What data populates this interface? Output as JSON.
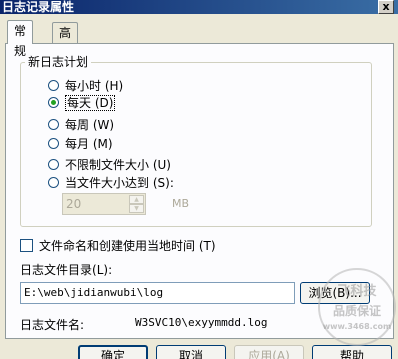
{
  "window": {
    "title": "日志记录属性",
    "close_glyph": "x"
  },
  "tabs": [
    {
      "label": "常规",
      "active": true
    },
    {
      "label": "高级",
      "active": false
    }
  ],
  "schedule": {
    "legend": "新日志计划",
    "options": [
      {
        "label": "每小时",
        "key": "(H)",
        "checked": false
      },
      {
        "label": "每天",
        "key": "(D)",
        "checked": true
      },
      {
        "label": "每周",
        "key": "(W)",
        "checked": false
      },
      {
        "label": "每月",
        "key": "(M)",
        "checked": false
      },
      {
        "label": "不限制文件大小",
        "key": "(U)",
        "checked": false
      },
      {
        "label": "当文件大小达到",
        "key": "(S):",
        "checked": false
      }
    ],
    "size_value": "20",
    "size_unit": "MB"
  },
  "local_time": {
    "label": "文件命名和创建使用当地时间",
    "key": "(T)",
    "checked": false
  },
  "log_dir": {
    "label": "日志文件目录",
    "key": "(L):",
    "value": "E:\\web\\jidianwubi\\log",
    "browse_label": "浏览(B)..."
  },
  "log_file": {
    "label": "日志文件名:",
    "value": "W3SVC10\\exyymmdd.log"
  },
  "buttons": {
    "ok": "确定",
    "cancel": "取消",
    "apply": "应用(A)",
    "help": "帮助"
  },
  "watermark": {
    "line1": "飞科技",
    "line2": "品质保证",
    "line3": "www.3468.com"
  }
}
